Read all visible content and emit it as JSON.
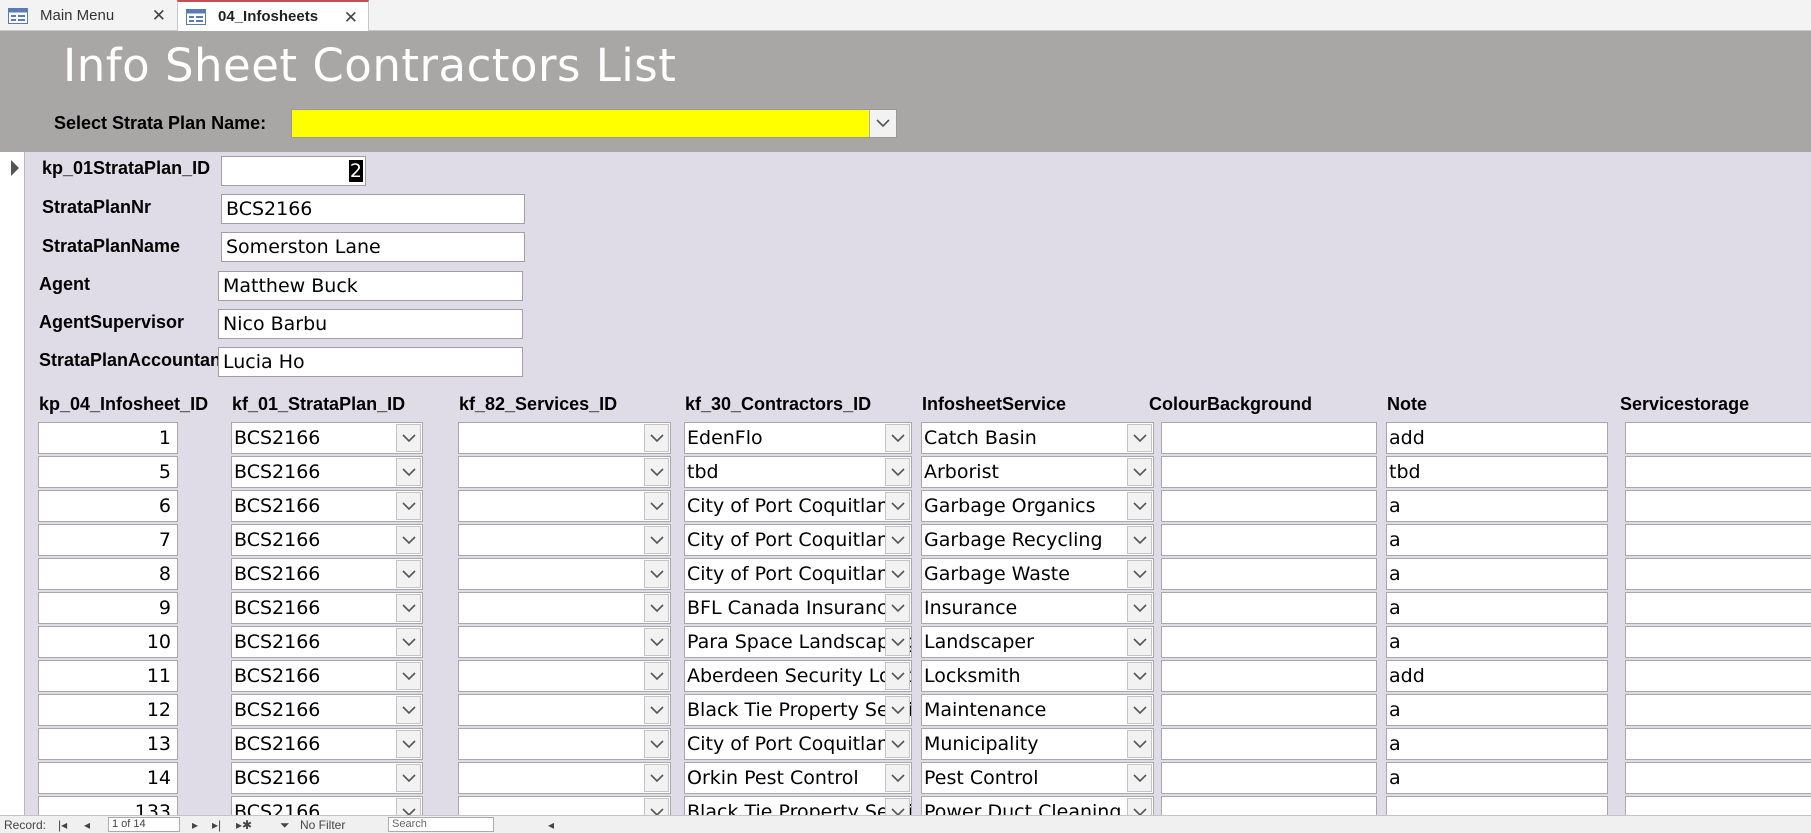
{
  "tabs": [
    {
      "label": "Main Menu",
      "active": false
    },
    {
      "label": "04_Infosheets",
      "active": true
    }
  ],
  "header": {
    "title": "Info Sheet Contractors List",
    "select_label": "Select Strata Plan Name:",
    "select_value": "",
    "select_color": "#ffff00"
  },
  "detail": {
    "fields": [
      {
        "label": "kp_01StrataPlan_ID",
        "value": "2"
      },
      {
        "label": "StrataPlanNr",
        "value": "BCS2166"
      },
      {
        "label": "StrataPlanName",
        "value": "Somerston Lane"
      },
      {
        "label": "Agent",
        "value": "Matthew Buck"
      },
      {
        "label": "AgentSupervisor",
        "value": "Nico Barbu"
      },
      {
        "label": "StrataPlanAccountant",
        "value": "Lucia Ho"
      }
    ]
  },
  "table": {
    "columns": [
      "kp_04_Infosheet_ID",
      "kf_01_StrataPlan_ID",
      "kf_82_Services_ID",
      "kf_30_Contractors_ID",
      "InfosheetService",
      "ColourBackground",
      "Note",
      "Servicestorage"
    ],
    "rows": [
      [
        "1",
        "BCS2166",
        "",
        "EdenFlo",
        "Catch Basin",
        "",
        "add",
        ""
      ],
      [
        "5",
        "BCS2166",
        "",
        " tbd",
        "Arborist",
        "",
        "tbd",
        ""
      ],
      [
        "6",
        "BCS2166",
        "",
        "City of Port Coquitlam",
        "Garbage Organics",
        "",
        "a",
        ""
      ],
      [
        "7",
        "BCS2166",
        "",
        "City of Port Coquitlam",
        "Garbage Recycling",
        "",
        "a",
        ""
      ],
      [
        "8",
        "BCS2166",
        "",
        "City of Port Coquitlam",
        "Garbage Waste",
        "",
        "a",
        ""
      ],
      [
        "9",
        "BCS2166",
        "",
        "BFL Canada Insurance",
        "Insurance",
        "",
        "a",
        ""
      ],
      [
        "10",
        "BCS2166",
        "",
        "Para Space Landscaping",
        "Landscaper",
        "",
        "a",
        ""
      ],
      [
        "11",
        "BCS2166",
        "",
        "Aberdeen Security Locksmith",
        "Locksmith",
        "",
        "add",
        ""
      ],
      [
        "12",
        "BCS2166",
        "",
        "Black Tie Property Services",
        "Maintenance",
        "",
        "a",
        ""
      ],
      [
        "13",
        "BCS2166",
        "",
        "City of Port Coquitlam",
        "Municipality",
        "",
        "a",
        ""
      ],
      [
        "14",
        "BCS2166",
        "",
        "Orkin Pest Control",
        "Pest Control",
        "",
        "a",
        ""
      ],
      [
        "133",
        "BCS2166",
        "",
        "Black Tie Property Services",
        "Power Duct Cleaning",
        "",
        "",
        ""
      ]
    ]
  },
  "navbar": {
    "record_label": "Record:",
    "counter": "1 of 14",
    "filter_label": "No Filter",
    "search_placeholder": "Search"
  }
}
